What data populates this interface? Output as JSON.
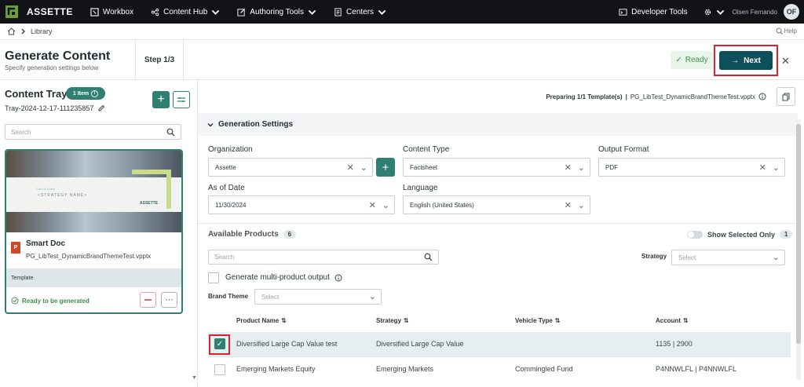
{
  "topbar": {
    "brand": "ASSETTE",
    "nav": [
      {
        "label": "Workbox"
      },
      {
        "label": "Content Hub"
      },
      {
        "label": "Authoring Tools"
      },
      {
        "label": "Centers"
      }
    ],
    "dev_tools": "Developer Tools",
    "user_name": "Olsen Fernando",
    "avatar_initials": "OF"
  },
  "breadcrumb": {
    "current": "Library"
  },
  "help": "Help",
  "header": {
    "title": "Generate Content",
    "subtitle": "Specify generation settings below",
    "step": "Step 1/3",
    "ready_label": "Ready",
    "next_label": "Next"
  },
  "tray": {
    "title": "Content Tray",
    "badge": "1 Item",
    "name": "Tray-2024-12-17-111235857",
    "search_placeholder": "Search",
    "card": {
      "thumb_heading": "<STRATEGY NAME>",
      "thumb_small": "Fact-of-Notes",
      "thumb_logo": "ASSETTE",
      "type": "Smart Doc",
      "file": "PG_LibTest_DynamicBrandThemeTest.vpptx",
      "icon_letter": "P",
      "category": "Template",
      "status": "Ready to be generated"
    }
  },
  "right": {
    "prep_label": "Preparing 1/1 Template(s)",
    "prep_sep": "|",
    "prep_file": "PG_LibTest_DynamicBrandThemeTest.vpptx",
    "section_title": "Generation Settings",
    "fields": {
      "organization": {
        "label": "Organization",
        "value": "Assette"
      },
      "content_type": {
        "label": "Content Type",
        "value": "Factsheet"
      },
      "output_format": {
        "label": "Output Format",
        "value": "PDF"
      },
      "as_of_date": {
        "label": "As of Date",
        "value": "11/30/2024"
      },
      "language": {
        "label": "Language",
        "value": "English (United States)"
      }
    },
    "products": {
      "title": "Available Products",
      "count": "6",
      "show_selected_label": "Show Selected Only",
      "show_selected_count": "1",
      "search_placeholder": "Search",
      "strategy_label": "Strategy",
      "strategy_placeholder": "Select",
      "multi_label": "Generate multi-product output",
      "brand_label": "Brand Theme",
      "brand_placeholder": "Select",
      "columns": [
        "Product Name",
        "Strategy",
        "Vehicle Type",
        "Account"
      ],
      "rows": [
        {
          "name": "Diversified Large Cap Value test",
          "strategy": "Diversified Large Cap Value",
          "vehicle": "",
          "account": "1135 | 2900",
          "selected": true
        },
        {
          "name": "Emerging Markets Equity",
          "strategy": "Emerging Markets",
          "vehicle": "Commingled Fund",
          "account": "P4NNWLFL | P4NNWLFL",
          "selected": false
        }
      ]
    }
  },
  "colors": {
    "accent": "#2f7f73",
    "primary_button": "#0e4f5c",
    "highlight": "#d9232f",
    "topbar": "#111316"
  }
}
